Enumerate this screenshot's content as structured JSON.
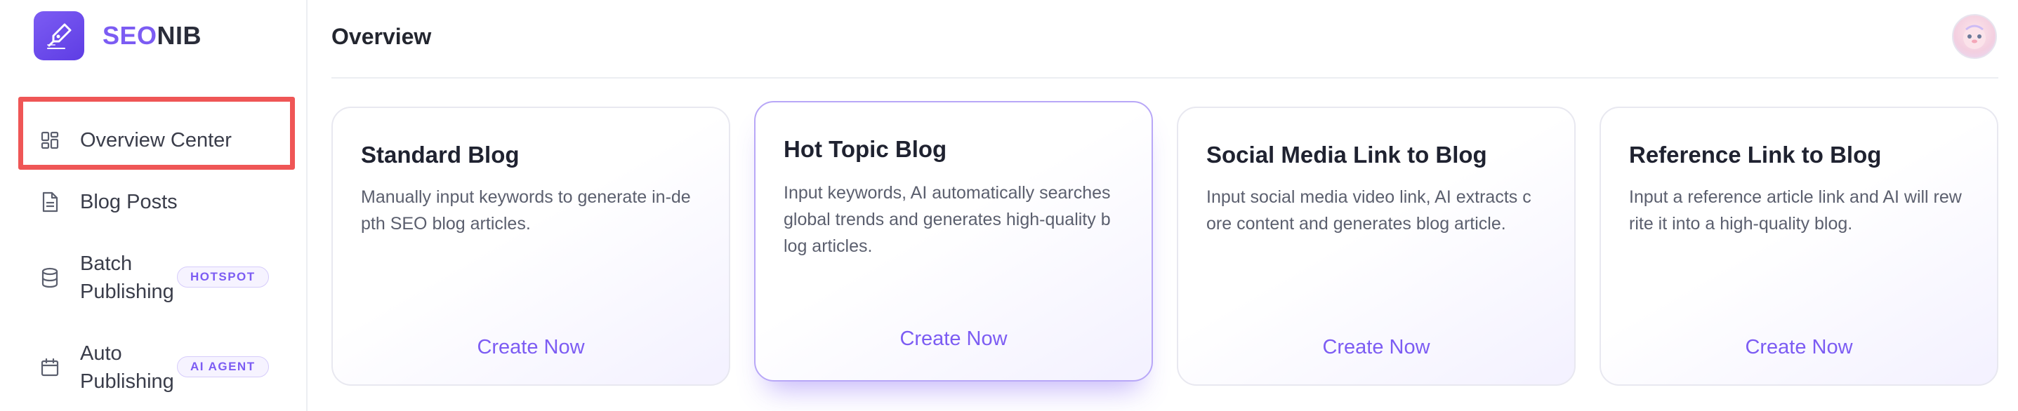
{
  "brand": {
    "name_part1": "SEO",
    "name_part2": "NIB",
    "logo_icon": "pen-nib-icon",
    "accent": "#7c5cf3"
  },
  "sidebar": {
    "items": [
      {
        "label": "Overview Center",
        "icon": "grid-icon",
        "highlighted": true
      },
      {
        "label": "Blog Posts",
        "icon": "document-icon"
      },
      {
        "label": "Batch Publishing",
        "icon": "database-icon",
        "badge": "HOTSPOT"
      },
      {
        "label": "Auto Publishing",
        "icon": "calendar-icon",
        "badge": "AI AGENT"
      }
    ]
  },
  "header": {
    "title": "Overview",
    "avatar_icon": "user-avatar"
  },
  "cards": [
    {
      "title": "Standard Blog",
      "description": "Manually input keywords to generate in-de pth SEO blog articles.",
      "cta": "Create Now"
    },
    {
      "title": "Hot Topic Blog",
      "description": "Input keywords, AI automatically searches global trends and generates high-quality b log articles.",
      "cta": "Create Now",
      "active": true
    },
    {
      "title": "Social Media Link to Blog",
      "description": "Input social media video link, AI extracts c ore content and generates blog article.",
      "cta": "Create Now"
    },
    {
      "title": "Reference Link to Blog",
      "description": "Input a reference article link and AI will rew rite it into a high-quality blog.",
      "cta": "Create Now"
    }
  ],
  "colors": {
    "highlight": "#ef5656",
    "text_primary": "#1f2230",
    "text_secondary": "#5b5f6e"
  }
}
